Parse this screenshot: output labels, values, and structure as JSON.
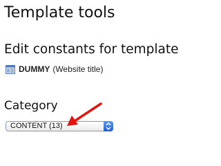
{
  "page": {
    "title": "Template tools"
  },
  "section": {
    "heading": "Edit constants for template"
  },
  "template": {
    "icon": "template-page-icon",
    "name": "DUMMY",
    "title": "(Website title)"
  },
  "category": {
    "label": "Category",
    "selected": "CONTENT (13)",
    "dropdown_icon": "select-updown-arrows-icon"
  },
  "annotation": {
    "icon": "red-arrow-icon",
    "color": "#e3140f"
  },
  "colors": {
    "select_accent": "#2f73e0",
    "select_border": "#7f9db9",
    "text": "#111111"
  }
}
